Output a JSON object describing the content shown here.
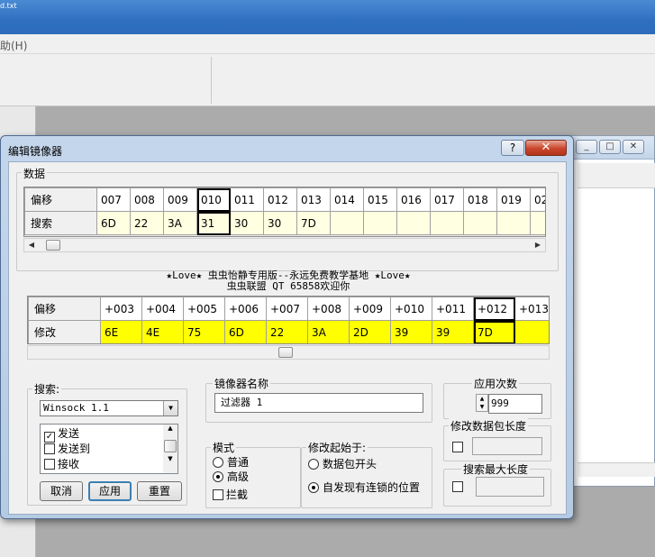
{
  "background_app": {
    "title_fragment": "d.txt",
    "menu_fragment": "助(H)"
  },
  "dialog": {
    "title": "编辑镜像器",
    "help_glyph": "?",
    "close_glyph": "✕",
    "data_group": "数据",
    "grid1": {
      "row_labels": [
        "偏移",
        "搜索"
      ],
      "offsets": [
        "007",
        "008",
        "009",
        "010",
        "011",
        "012",
        "013",
        "014",
        "015",
        "016",
        "017",
        "018",
        "019",
        "02"
      ],
      "values": [
        "6D",
        "22",
        "3A",
        "31",
        "30",
        "30",
        "7D",
        "",
        "",
        "",
        "",
        "",
        "",
        ""
      ]
    },
    "banner_line1": "★Love★  虫虫怡静专用版--永远免费教学基地 ★Love★",
    "banner_line2": "虫虫联盟 QT 65858欢迎你",
    "grid2": {
      "row_labels": [
        "偏移",
        "修改"
      ],
      "offsets": [
        "+003",
        "+004",
        "+005",
        "+006",
        "+007",
        "+008",
        "+009",
        "+010",
        "+011",
        "+012",
        "+013"
      ],
      "values": [
        "6E",
        "4E",
        "75",
        "6D",
        "22",
        "3A",
        "2D",
        "39",
        "39",
        "7D",
        ""
      ]
    },
    "search_group": "搜索:",
    "search_combo_value": "Winsock 1.1",
    "search_list": [
      {
        "label": "发送",
        "checked": true
      },
      {
        "label": "发送到",
        "checked": false
      },
      {
        "label": "接收",
        "checked": false
      }
    ],
    "buttons": {
      "cancel": "取消",
      "apply": "应用",
      "reset": "重置"
    },
    "mirror_name_group": "镜像器名称",
    "mirror_name_value": "过滤器 1",
    "mode_group": "模式",
    "mode_options": [
      {
        "label": "普通",
        "selected": false
      },
      {
        "label": "高级",
        "selected": true
      }
    ],
    "intercept_label": "拦截",
    "modify_start_group": "修改起始于:",
    "modify_start_options": [
      {
        "label": "数据包开头",
        "selected": false
      },
      {
        "label": "自发现有连锁的位置",
        "selected": true
      }
    ],
    "apply_count_group": "应用次数",
    "apply_count_value": "999",
    "modify_len_group": "修改数据包长度",
    "search_max_len_group": "搜索最大长度"
  }
}
